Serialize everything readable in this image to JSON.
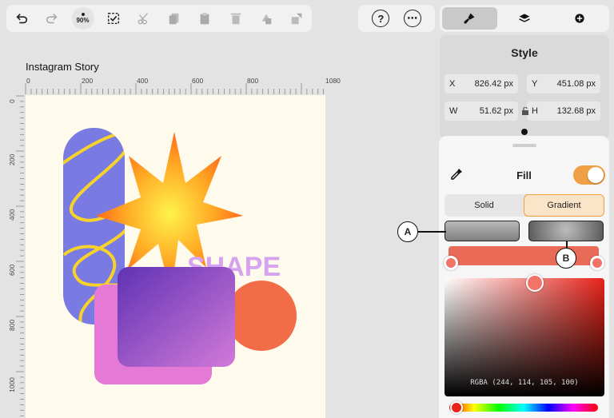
{
  "toolbar": {
    "buttons": [
      {
        "name": "undo-button",
        "icon": "undo-icon"
      },
      {
        "name": "redo-button",
        "icon": "redo-icon"
      },
      {
        "name": "zoom-button",
        "icon": "zoom-indicator"
      },
      {
        "name": "select-button",
        "icon": "select-icon"
      },
      {
        "name": "cut-button",
        "icon": "scissors-icon"
      },
      {
        "name": "copy-button",
        "icon": "copy-icon"
      },
      {
        "name": "paste-button",
        "icon": "paste-icon"
      },
      {
        "name": "delete-button",
        "icon": "trash-icon"
      },
      {
        "name": "duplicate-button",
        "icon": "duplicate-icon"
      },
      {
        "name": "export-button",
        "icon": "export-icon"
      }
    ],
    "zoom_label": "90%",
    "help_icon": "?",
    "more_icon": "⋯"
  },
  "tabs": [
    {
      "name": "tab-style",
      "icon": "brush-icon",
      "active": true
    },
    {
      "name": "tab-layers",
      "icon": "layers-icon",
      "active": false
    },
    {
      "name": "tab-add",
      "icon": "plus-circle-icon",
      "active": false
    }
  ],
  "document": {
    "title": "Instagram Story",
    "ruler_h": [
      "0",
      "200",
      "400",
      "600",
      "800",
      "1080"
    ],
    "ruler_v": [
      "0",
      "200",
      "400",
      "600",
      "800",
      "1000"
    ],
    "shape_text": "SHAPE"
  },
  "style_panel": {
    "title": "Style",
    "x_label": "X",
    "x_value": "826.42 px",
    "y_label": "Y",
    "y_value": "451.08 px",
    "w_label": "W",
    "w_value": "51.62 px",
    "h_label": "H",
    "h_value": "132.68 px"
  },
  "fill": {
    "label": "Fill",
    "enabled": true,
    "modes": [
      "Solid",
      "Gradient"
    ],
    "active_mode": "Gradient",
    "rgba_text": "RGBA (244, 114, 105, 100)",
    "color": "#f47269",
    "accent": "#f0a044"
  },
  "callouts": {
    "a": "A",
    "b": "B"
  }
}
